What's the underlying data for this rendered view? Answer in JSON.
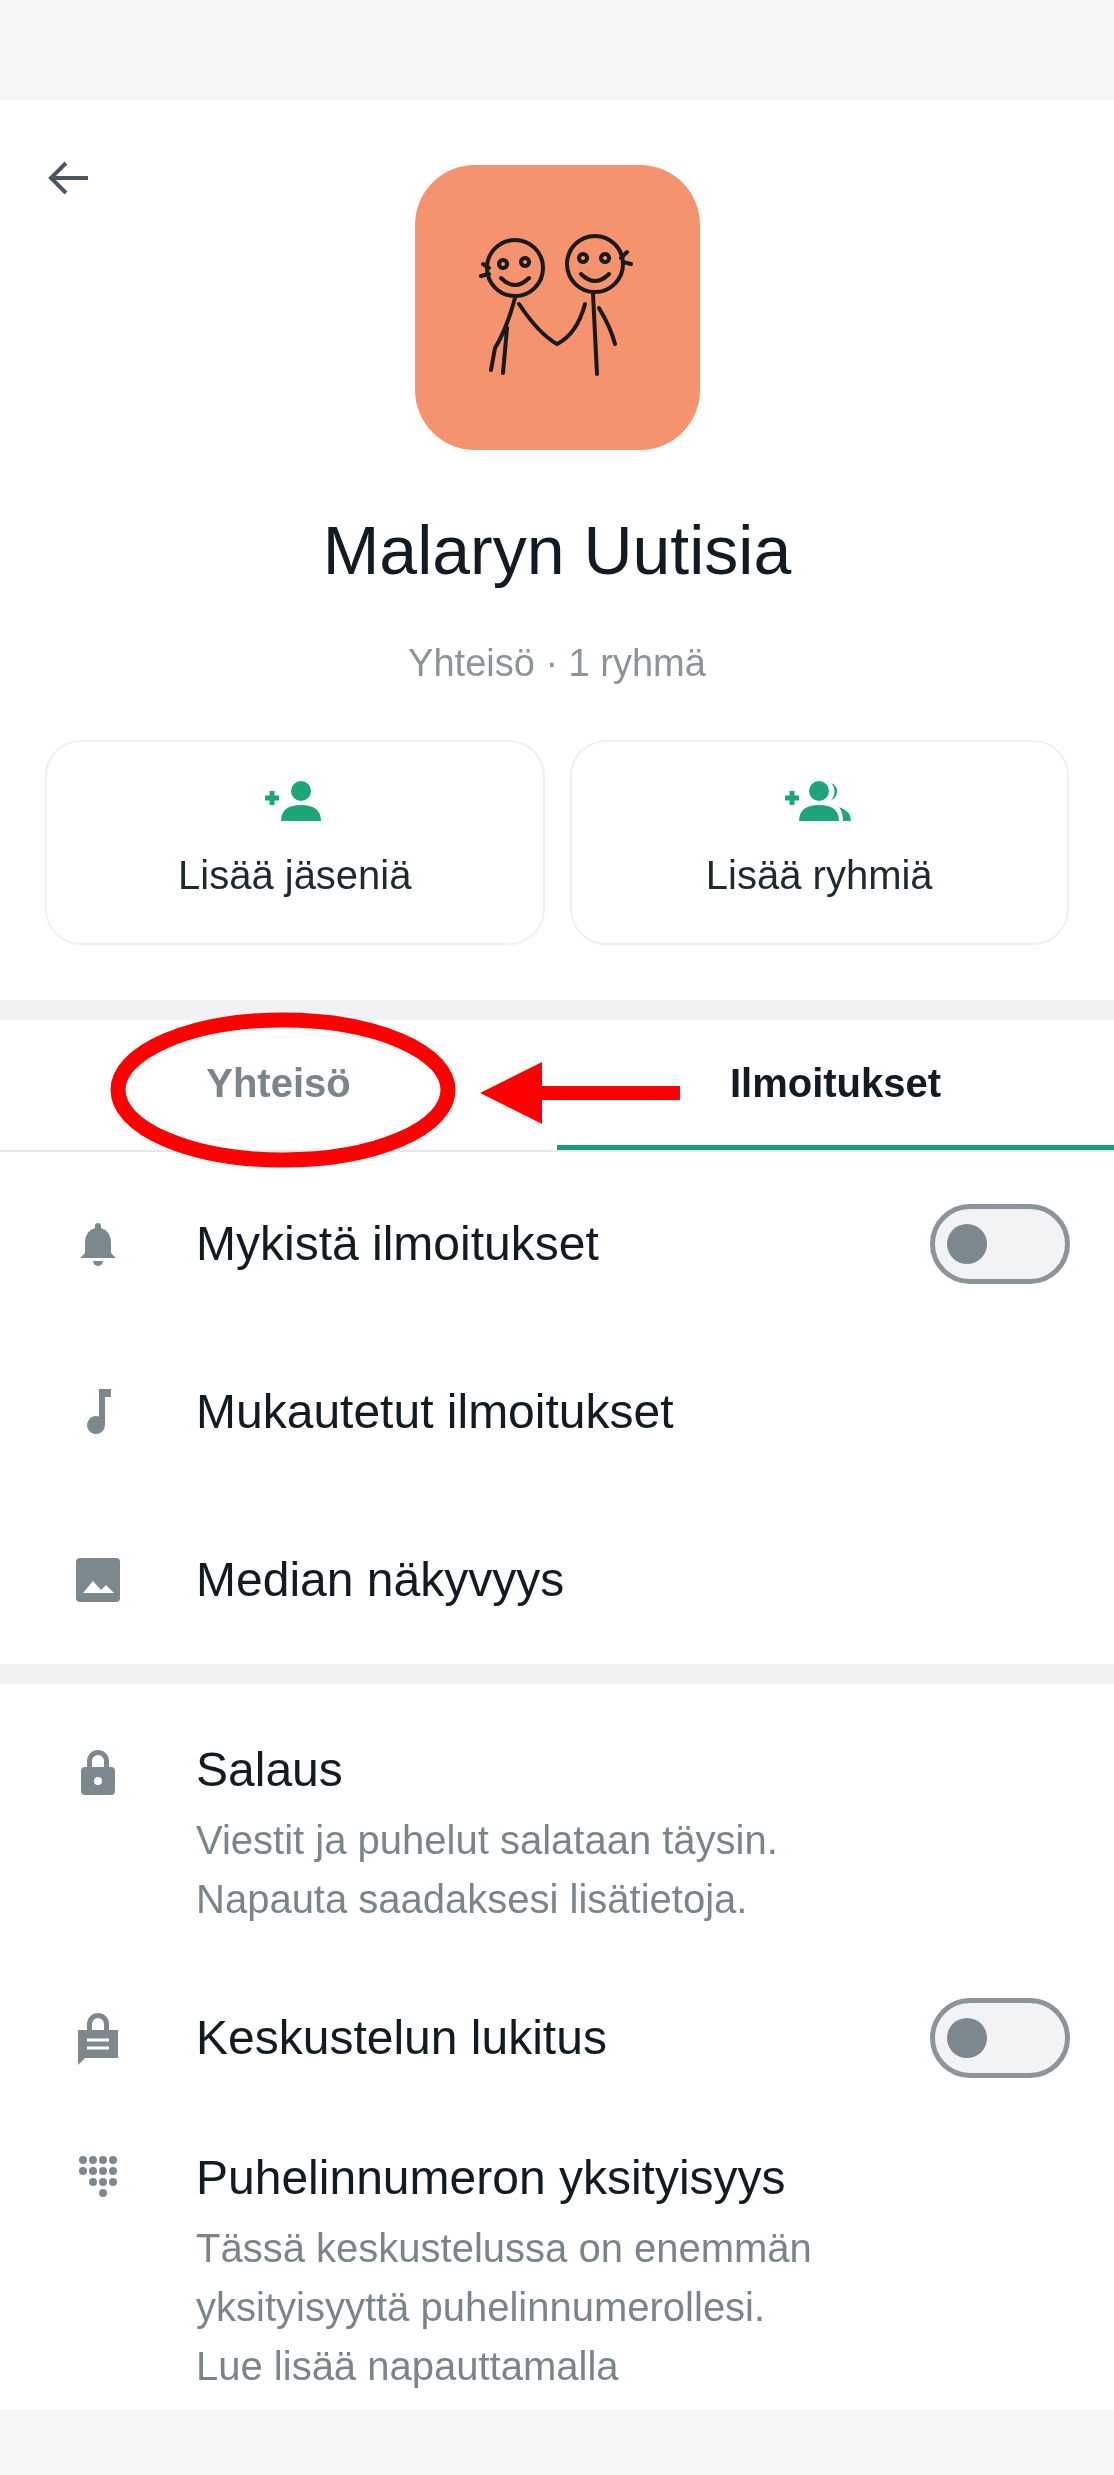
{
  "group": {
    "name": "Malaryn Uutisia",
    "subtitle": "Yhteisö · 1 ryhmä"
  },
  "actions": [
    {
      "kind": "add-member",
      "label": "Lisää jäseniä"
    },
    {
      "kind": "add-group",
      "label": "Lisää ryhmiä"
    }
  ],
  "tabs": [
    {
      "label": "Yhteisö",
      "selected": false
    },
    {
      "label": "Ilmoitukset",
      "selected": true
    }
  ],
  "sections": [
    {
      "items": [
        {
          "title": "Mykistä ilmoitukset",
          "on": false
        },
        {
          "title": "Mukautetut ilmoitukset"
        },
        {
          "title": "Median näkyvyys"
        }
      ]
    },
    {
      "items": [
        {
          "title": "Salaus",
          "description": "Viestit ja puhelut salataan täysin.\nNapauta saadaksesi lisätietoja."
        },
        {
          "title": "Keskustelun lukitus",
          "on": false
        },
        {
          "title": "Puhelinnumeron yksityisyys",
          "description": "Tässä keskustelussa on enemmän\nyksityisyyttä puhelinnumerollesi.\nLue lisää napauttamalla"
        }
      ]
    }
  ]
}
